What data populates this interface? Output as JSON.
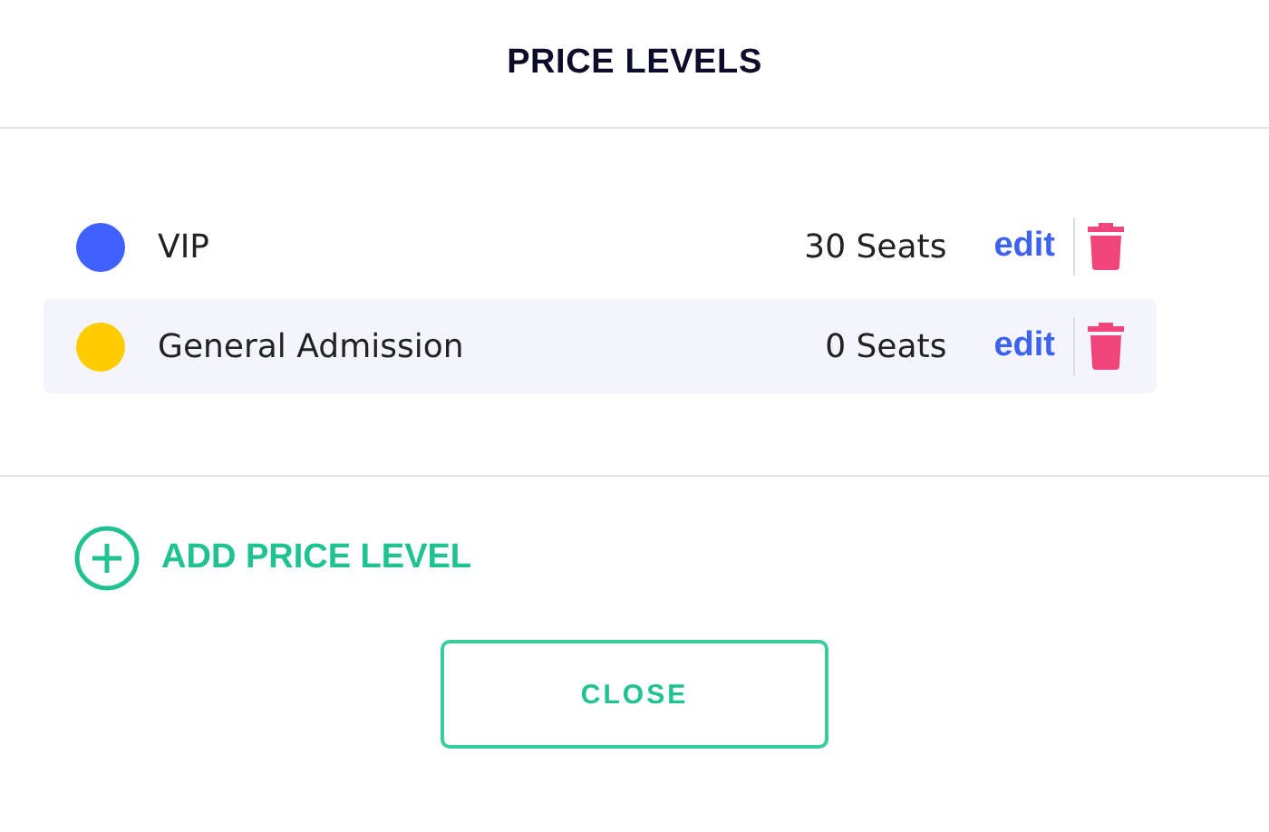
{
  "title": "PRICE LEVELS",
  "levels": [
    {
      "name": "VIP",
      "seats": "30 Seats",
      "color": "#4060ff",
      "edit": "edit",
      "selected": false
    },
    {
      "name": "General Admission",
      "seats": "0 Seats",
      "color": "#ffcc00",
      "edit": "edit",
      "selected": true
    }
  ],
  "add_button": "ADD PRICE LEVEL",
  "close_button": "CLOSE"
}
